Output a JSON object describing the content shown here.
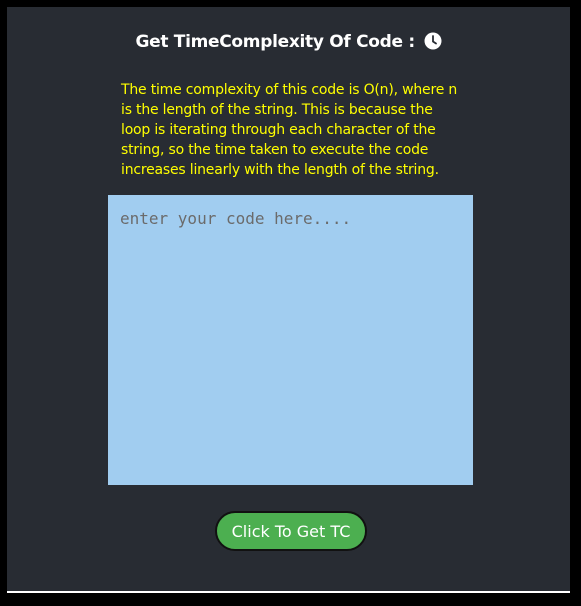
{
  "header": {
    "title": "Get TimeComplexity Of Code :",
    "icon": "clock-icon"
  },
  "result": {
    "text": "The time complexity of this code is O(n), where n is the length of the string. This is because the loop is iterating through each character of the string, so the time taken to execute the code increases linearly with the length of the string."
  },
  "editor": {
    "placeholder": "enter your code here....",
    "value": ""
  },
  "actions": {
    "submit_label": "Click To Get TC"
  },
  "colors": {
    "background": "#282c33",
    "result_text": "#ffff00",
    "editor_bg": "#a1cdf0",
    "button_bg": "#4caf50"
  }
}
